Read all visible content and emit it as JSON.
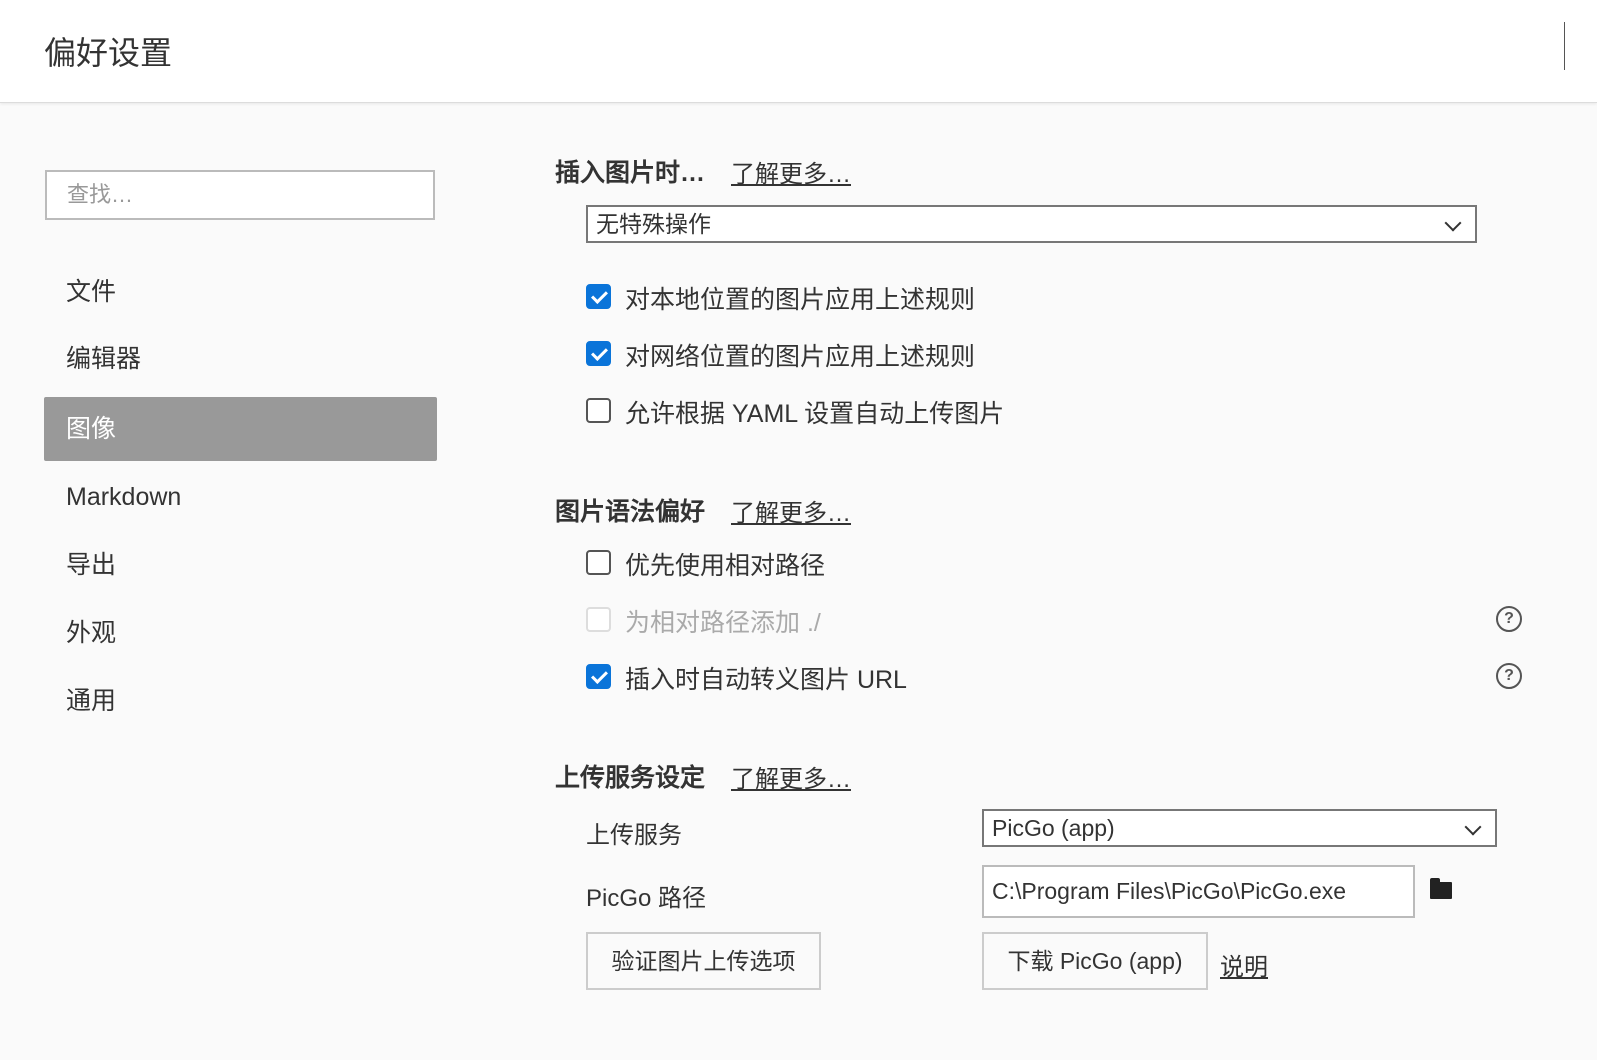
{
  "header": {
    "title": "偏好设置"
  },
  "sidebar": {
    "search_placeholder": "查找…",
    "items": [
      {
        "label": "文件",
        "active": false
      },
      {
        "label": "编辑器",
        "active": false
      },
      {
        "label": "图像",
        "active": true
      },
      {
        "label": "Markdown",
        "active": false
      },
      {
        "label": "导出",
        "active": false
      },
      {
        "label": "外观",
        "active": false
      },
      {
        "label": "通用",
        "active": false
      }
    ]
  },
  "insert_section": {
    "title": "插入图片时…",
    "learn_more": "了解更多…",
    "action_select": "无特殊操作",
    "options": [
      {
        "label": "对本地位置的图片应用上述规则",
        "checked": true,
        "disabled": false
      },
      {
        "label": "对网络位置的图片应用上述规则",
        "checked": true,
        "disabled": false
      },
      {
        "label": "允许根据 YAML 设置自动上传图片",
        "checked": false,
        "disabled": false
      }
    ]
  },
  "syntax_section": {
    "title": "图片语法偏好",
    "learn_more": "了解更多…",
    "options": [
      {
        "label": "优先使用相对路径",
        "checked": false,
        "disabled": false
      },
      {
        "label": "为相对路径添加 ./",
        "checked": false,
        "disabled": true
      },
      {
        "label": "插入时自动转义图片 URL",
        "checked": true,
        "disabled": false
      }
    ],
    "help_icon": "question-circle-icon"
  },
  "upload_section": {
    "title": "上传服务设定",
    "learn_more": "了解更多…",
    "service_label": "上传服务",
    "service_value": "PicGo (app)",
    "path_label": "PicGo 路径",
    "path_value": "C:\\Program Files\\PicGo\\PicGo.exe",
    "verify_button": "验证图片上传选项",
    "download_button": "下载 PicGo (app)",
    "help_link": "说明"
  },
  "colors": {
    "accent": "#0a74d9",
    "active_nav": "#999999",
    "background": "#fafafa"
  }
}
